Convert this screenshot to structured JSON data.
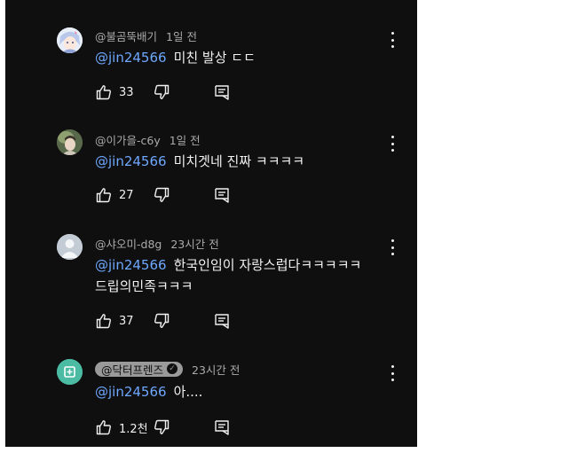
{
  "comments": [
    {
      "author": "@불곰뚝배기",
      "time": "1일 전",
      "mention": "@jin24566",
      "text": "미친 발상 ㄷㄷ",
      "likes": "33",
      "avatar_icon": "anime-character-avatar"
    },
    {
      "author": "@이가을-c6y",
      "time": "1일 전",
      "mention": "@jin24566",
      "text": "미치겟네 진짜 ㅋㅋㅋㅋ",
      "likes": "27",
      "avatar_icon": "photo-avatar"
    },
    {
      "author": "@샤오미-d8g",
      "time": "23시간 전",
      "mention": "@jin24566",
      "text": "한국인임이 자랑스럽다ㅋㅋㅋㅋㅋ",
      "text_line2": "드립의민족ㅋㅋㅋ",
      "likes": "37",
      "avatar_icon": "default-user-avatar"
    },
    {
      "author": "@닥터프렌즈",
      "time": "23시간 전",
      "mention": "@jin24566",
      "text": "아....",
      "likes": "1.2천",
      "verified": true,
      "avatar_icon": "channel-plus-avatar"
    }
  ],
  "colors": {
    "background": "#0f0f0f",
    "mention": "#6ea8ff",
    "text": "#f1f1f1",
    "meta": "#aaaaaa",
    "owner_pill": "#9a9a9a"
  },
  "icons": [
    "thumbs-up-icon",
    "thumbs-down-icon",
    "reply-icon",
    "more-options-icon",
    "verified-check-icon"
  ]
}
